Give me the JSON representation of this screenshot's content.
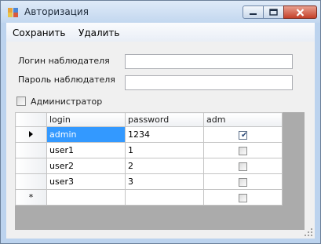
{
  "window": {
    "title": "Авторизация",
    "accent": "#c4412a",
    "icon": "app-form-icon",
    "controls": {
      "minimize": "minimize-icon",
      "maximize": "maximize-icon",
      "close": "close-icon"
    }
  },
  "menu": {
    "save_label": "Сохранить",
    "delete_label": "Удалить"
  },
  "form": {
    "login_label": "Логин наблюдателя",
    "login_value": "",
    "password_label": "Пароль наблюдателя",
    "password_value": "",
    "admin_label": "Администратор",
    "admin_checked": false
  },
  "grid": {
    "columns": [
      "login",
      "password",
      "adm"
    ],
    "rows": [
      {
        "login": "admin",
        "password": "1234",
        "adm": true
      },
      {
        "login": "user1",
        "password": "1",
        "adm": false
      },
      {
        "login": "user2",
        "password": "2",
        "adm": false
      },
      {
        "login": "user3",
        "password": "3",
        "adm": false
      }
    ],
    "new_row_marker": "*",
    "current_row_icon": "row-pointer-icon",
    "selection_color": "#3399ff"
  }
}
